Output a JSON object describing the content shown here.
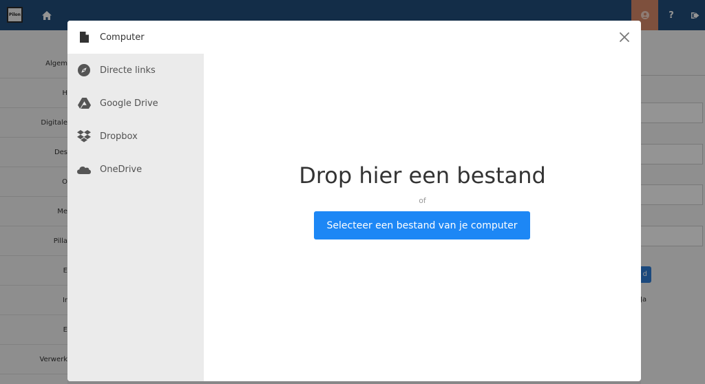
{
  "app": {
    "logo_text": "Pilon",
    "help_label": "?"
  },
  "background": {
    "sidebar_rows": [
      "Algem",
      "H",
      "Digitale",
      "Des",
      "O",
      "Me",
      "Pilla",
      "E",
      "Ir",
      "E",
      "Verwerk"
    ],
    "button_fragment": "d",
    "radio_label": "Ja"
  },
  "modal": {
    "nav": [
      {
        "label": "Computer",
        "icon": "file-icon"
      },
      {
        "label": "Directe links",
        "icon": "compass-icon"
      },
      {
        "label": "Google Drive",
        "icon": "google-drive-icon"
      },
      {
        "label": "Dropbox",
        "icon": "dropbox-icon"
      },
      {
        "label": "OneDrive",
        "icon": "onedrive-icon"
      }
    ],
    "drop_title": "Drop hier een bestand",
    "or_text": "of",
    "select_button": "Selecteer een bestand van je computer"
  },
  "colors": {
    "topbar": "#214f7d",
    "user_button": "#d98b6a",
    "primary_button": "#1d87f5",
    "modal_nav": "#ebebeb"
  }
}
